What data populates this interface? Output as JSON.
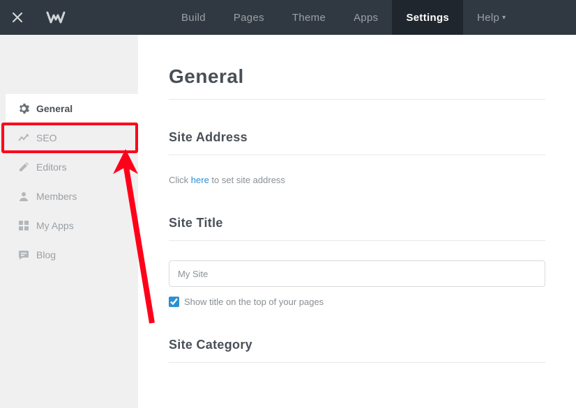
{
  "nav": {
    "tabs": [
      {
        "label": "Build"
      },
      {
        "label": "Pages"
      },
      {
        "label": "Theme"
      },
      {
        "label": "Apps"
      },
      {
        "label": "Settings"
      },
      {
        "label": "Help"
      }
    ]
  },
  "sidebar": {
    "items": [
      {
        "label": "General"
      },
      {
        "label": "SEO"
      },
      {
        "label": "Editors"
      },
      {
        "label": "Members"
      },
      {
        "label": "My Apps"
      },
      {
        "label": "Blog"
      }
    ]
  },
  "page": {
    "title": "General",
    "address_heading": "Site Address",
    "address_hint_pre": "Click ",
    "address_hint_link": "here",
    "address_hint_post": " to set site address",
    "title_heading": "Site Title",
    "title_value": "My Site",
    "title_checkbox_label": "Show title on the top of your pages",
    "category_heading": "Site Category"
  }
}
